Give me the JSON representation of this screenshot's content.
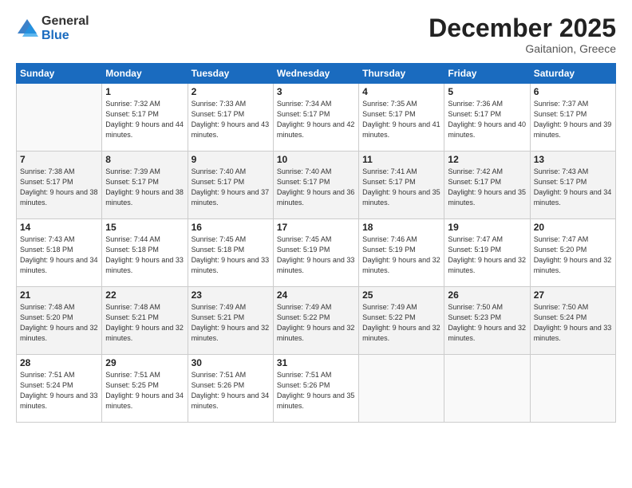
{
  "logo": {
    "general": "General",
    "blue": "Blue"
  },
  "header": {
    "month": "December 2025",
    "location": "Gaitanion, Greece"
  },
  "days_of_week": [
    "Sunday",
    "Monday",
    "Tuesday",
    "Wednesday",
    "Thursday",
    "Friday",
    "Saturday"
  ],
  "weeks": [
    [
      {
        "day": "",
        "sunrise": "",
        "sunset": "",
        "daylight": ""
      },
      {
        "day": "1",
        "sunrise": "Sunrise: 7:32 AM",
        "sunset": "Sunset: 5:17 PM",
        "daylight": "Daylight: 9 hours and 44 minutes."
      },
      {
        "day": "2",
        "sunrise": "Sunrise: 7:33 AM",
        "sunset": "Sunset: 5:17 PM",
        "daylight": "Daylight: 9 hours and 43 minutes."
      },
      {
        "day": "3",
        "sunrise": "Sunrise: 7:34 AM",
        "sunset": "Sunset: 5:17 PM",
        "daylight": "Daylight: 9 hours and 42 minutes."
      },
      {
        "day": "4",
        "sunrise": "Sunrise: 7:35 AM",
        "sunset": "Sunset: 5:17 PM",
        "daylight": "Daylight: 9 hours and 41 minutes."
      },
      {
        "day": "5",
        "sunrise": "Sunrise: 7:36 AM",
        "sunset": "Sunset: 5:17 PM",
        "daylight": "Daylight: 9 hours and 40 minutes."
      },
      {
        "day": "6",
        "sunrise": "Sunrise: 7:37 AM",
        "sunset": "Sunset: 5:17 PM",
        "daylight": "Daylight: 9 hours and 39 minutes."
      }
    ],
    [
      {
        "day": "7",
        "sunrise": "Sunrise: 7:38 AM",
        "sunset": "Sunset: 5:17 PM",
        "daylight": "Daylight: 9 hours and 38 minutes."
      },
      {
        "day": "8",
        "sunrise": "Sunrise: 7:39 AM",
        "sunset": "Sunset: 5:17 PM",
        "daylight": "Daylight: 9 hours and 38 minutes."
      },
      {
        "day": "9",
        "sunrise": "Sunrise: 7:40 AM",
        "sunset": "Sunset: 5:17 PM",
        "daylight": "Daylight: 9 hours and 37 minutes."
      },
      {
        "day": "10",
        "sunrise": "Sunrise: 7:40 AM",
        "sunset": "Sunset: 5:17 PM",
        "daylight": "Daylight: 9 hours and 36 minutes."
      },
      {
        "day": "11",
        "sunrise": "Sunrise: 7:41 AM",
        "sunset": "Sunset: 5:17 PM",
        "daylight": "Daylight: 9 hours and 35 minutes."
      },
      {
        "day": "12",
        "sunrise": "Sunrise: 7:42 AM",
        "sunset": "Sunset: 5:17 PM",
        "daylight": "Daylight: 9 hours and 35 minutes."
      },
      {
        "day": "13",
        "sunrise": "Sunrise: 7:43 AM",
        "sunset": "Sunset: 5:17 PM",
        "daylight": "Daylight: 9 hours and 34 minutes."
      }
    ],
    [
      {
        "day": "14",
        "sunrise": "Sunrise: 7:43 AM",
        "sunset": "Sunset: 5:18 PM",
        "daylight": "Daylight: 9 hours and 34 minutes."
      },
      {
        "day": "15",
        "sunrise": "Sunrise: 7:44 AM",
        "sunset": "Sunset: 5:18 PM",
        "daylight": "Daylight: 9 hours and 33 minutes."
      },
      {
        "day": "16",
        "sunrise": "Sunrise: 7:45 AM",
        "sunset": "Sunset: 5:18 PM",
        "daylight": "Daylight: 9 hours and 33 minutes."
      },
      {
        "day": "17",
        "sunrise": "Sunrise: 7:45 AM",
        "sunset": "Sunset: 5:19 PM",
        "daylight": "Daylight: 9 hours and 33 minutes."
      },
      {
        "day": "18",
        "sunrise": "Sunrise: 7:46 AM",
        "sunset": "Sunset: 5:19 PM",
        "daylight": "Daylight: 9 hours and 32 minutes."
      },
      {
        "day": "19",
        "sunrise": "Sunrise: 7:47 AM",
        "sunset": "Sunset: 5:19 PM",
        "daylight": "Daylight: 9 hours and 32 minutes."
      },
      {
        "day": "20",
        "sunrise": "Sunrise: 7:47 AM",
        "sunset": "Sunset: 5:20 PM",
        "daylight": "Daylight: 9 hours and 32 minutes."
      }
    ],
    [
      {
        "day": "21",
        "sunrise": "Sunrise: 7:48 AM",
        "sunset": "Sunset: 5:20 PM",
        "daylight": "Daylight: 9 hours and 32 minutes."
      },
      {
        "day": "22",
        "sunrise": "Sunrise: 7:48 AM",
        "sunset": "Sunset: 5:21 PM",
        "daylight": "Daylight: 9 hours and 32 minutes."
      },
      {
        "day": "23",
        "sunrise": "Sunrise: 7:49 AM",
        "sunset": "Sunset: 5:21 PM",
        "daylight": "Daylight: 9 hours and 32 minutes."
      },
      {
        "day": "24",
        "sunrise": "Sunrise: 7:49 AM",
        "sunset": "Sunset: 5:22 PM",
        "daylight": "Daylight: 9 hours and 32 minutes."
      },
      {
        "day": "25",
        "sunrise": "Sunrise: 7:49 AM",
        "sunset": "Sunset: 5:22 PM",
        "daylight": "Daylight: 9 hours and 32 minutes."
      },
      {
        "day": "26",
        "sunrise": "Sunrise: 7:50 AM",
        "sunset": "Sunset: 5:23 PM",
        "daylight": "Daylight: 9 hours and 32 minutes."
      },
      {
        "day": "27",
        "sunrise": "Sunrise: 7:50 AM",
        "sunset": "Sunset: 5:24 PM",
        "daylight": "Daylight: 9 hours and 33 minutes."
      }
    ],
    [
      {
        "day": "28",
        "sunrise": "Sunrise: 7:51 AM",
        "sunset": "Sunset: 5:24 PM",
        "daylight": "Daylight: 9 hours and 33 minutes."
      },
      {
        "day": "29",
        "sunrise": "Sunrise: 7:51 AM",
        "sunset": "Sunset: 5:25 PM",
        "daylight": "Daylight: 9 hours and 34 minutes."
      },
      {
        "day": "30",
        "sunrise": "Sunrise: 7:51 AM",
        "sunset": "Sunset: 5:26 PM",
        "daylight": "Daylight: 9 hours and 34 minutes."
      },
      {
        "day": "31",
        "sunrise": "Sunrise: 7:51 AM",
        "sunset": "Sunset: 5:26 PM",
        "daylight": "Daylight: 9 hours and 35 minutes."
      },
      {
        "day": "",
        "sunrise": "",
        "sunset": "",
        "daylight": ""
      },
      {
        "day": "",
        "sunrise": "",
        "sunset": "",
        "daylight": ""
      },
      {
        "day": "",
        "sunrise": "",
        "sunset": "",
        "daylight": ""
      }
    ]
  ]
}
